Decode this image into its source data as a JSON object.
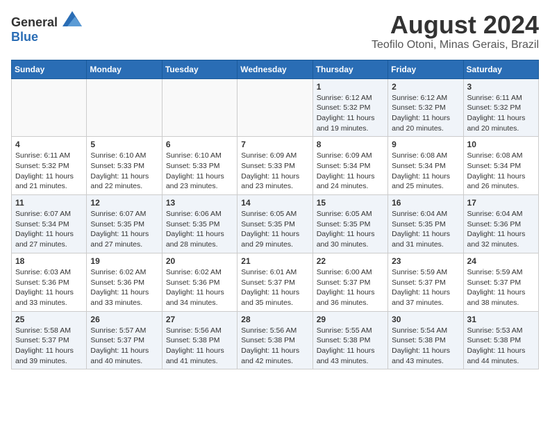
{
  "logo": {
    "text_general": "General",
    "text_blue": "Blue"
  },
  "title": {
    "month_year": "August 2024",
    "location": "Teofilo Otoni, Minas Gerais, Brazil"
  },
  "weekdays": [
    "Sunday",
    "Monday",
    "Tuesday",
    "Wednesday",
    "Thursday",
    "Friday",
    "Saturday"
  ],
  "weeks": [
    [
      {
        "day": "",
        "info": ""
      },
      {
        "day": "",
        "info": ""
      },
      {
        "day": "",
        "info": ""
      },
      {
        "day": "",
        "info": ""
      },
      {
        "day": "1",
        "info": "Sunrise: 6:12 AM\nSunset: 5:32 PM\nDaylight: 11 hours and 19 minutes."
      },
      {
        "day": "2",
        "info": "Sunrise: 6:12 AM\nSunset: 5:32 PM\nDaylight: 11 hours and 20 minutes."
      },
      {
        "day": "3",
        "info": "Sunrise: 6:11 AM\nSunset: 5:32 PM\nDaylight: 11 hours and 20 minutes."
      }
    ],
    [
      {
        "day": "4",
        "info": "Sunrise: 6:11 AM\nSunset: 5:32 PM\nDaylight: 11 hours and 21 minutes."
      },
      {
        "day": "5",
        "info": "Sunrise: 6:10 AM\nSunset: 5:33 PM\nDaylight: 11 hours and 22 minutes."
      },
      {
        "day": "6",
        "info": "Sunrise: 6:10 AM\nSunset: 5:33 PM\nDaylight: 11 hours and 23 minutes."
      },
      {
        "day": "7",
        "info": "Sunrise: 6:09 AM\nSunset: 5:33 PM\nDaylight: 11 hours and 23 minutes."
      },
      {
        "day": "8",
        "info": "Sunrise: 6:09 AM\nSunset: 5:34 PM\nDaylight: 11 hours and 24 minutes."
      },
      {
        "day": "9",
        "info": "Sunrise: 6:08 AM\nSunset: 5:34 PM\nDaylight: 11 hours and 25 minutes."
      },
      {
        "day": "10",
        "info": "Sunrise: 6:08 AM\nSunset: 5:34 PM\nDaylight: 11 hours and 26 minutes."
      }
    ],
    [
      {
        "day": "11",
        "info": "Sunrise: 6:07 AM\nSunset: 5:34 PM\nDaylight: 11 hours and 27 minutes."
      },
      {
        "day": "12",
        "info": "Sunrise: 6:07 AM\nSunset: 5:35 PM\nDaylight: 11 hours and 27 minutes."
      },
      {
        "day": "13",
        "info": "Sunrise: 6:06 AM\nSunset: 5:35 PM\nDaylight: 11 hours and 28 minutes."
      },
      {
        "day": "14",
        "info": "Sunrise: 6:05 AM\nSunset: 5:35 PM\nDaylight: 11 hours and 29 minutes."
      },
      {
        "day": "15",
        "info": "Sunrise: 6:05 AM\nSunset: 5:35 PM\nDaylight: 11 hours and 30 minutes."
      },
      {
        "day": "16",
        "info": "Sunrise: 6:04 AM\nSunset: 5:35 PM\nDaylight: 11 hours and 31 minutes."
      },
      {
        "day": "17",
        "info": "Sunrise: 6:04 AM\nSunset: 5:36 PM\nDaylight: 11 hours and 32 minutes."
      }
    ],
    [
      {
        "day": "18",
        "info": "Sunrise: 6:03 AM\nSunset: 5:36 PM\nDaylight: 11 hours and 33 minutes."
      },
      {
        "day": "19",
        "info": "Sunrise: 6:02 AM\nSunset: 5:36 PM\nDaylight: 11 hours and 33 minutes."
      },
      {
        "day": "20",
        "info": "Sunrise: 6:02 AM\nSunset: 5:36 PM\nDaylight: 11 hours and 34 minutes."
      },
      {
        "day": "21",
        "info": "Sunrise: 6:01 AM\nSunset: 5:37 PM\nDaylight: 11 hours and 35 minutes."
      },
      {
        "day": "22",
        "info": "Sunrise: 6:00 AM\nSunset: 5:37 PM\nDaylight: 11 hours and 36 minutes."
      },
      {
        "day": "23",
        "info": "Sunrise: 5:59 AM\nSunset: 5:37 PM\nDaylight: 11 hours and 37 minutes."
      },
      {
        "day": "24",
        "info": "Sunrise: 5:59 AM\nSunset: 5:37 PM\nDaylight: 11 hours and 38 minutes."
      }
    ],
    [
      {
        "day": "25",
        "info": "Sunrise: 5:58 AM\nSunset: 5:37 PM\nDaylight: 11 hours and 39 minutes."
      },
      {
        "day": "26",
        "info": "Sunrise: 5:57 AM\nSunset: 5:37 PM\nDaylight: 11 hours and 40 minutes."
      },
      {
        "day": "27",
        "info": "Sunrise: 5:56 AM\nSunset: 5:38 PM\nDaylight: 11 hours and 41 minutes."
      },
      {
        "day": "28",
        "info": "Sunrise: 5:56 AM\nSunset: 5:38 PM\nDaylight: 11 hours and 42 minutes."
      },
      {
        "day": "29",
        "info": "Sunrise: 5:55 AM\nSunset: 5:38 PM\nDaylight: 11 hours and 43 minutes."
      },
      {
        "day": "30",
        "info": "Sunrise: 5:54 AM\nSunset: 5:38 PM\nDaylight: 11 hours and 43 minutes."
      },
      {
        "day": "31",
        "info": "Sunrise: 5:53 AM\nSunset: 5:38 PM\nDaylight: 11 hours and 44 minutes."
      }
    ]
  ]
}
